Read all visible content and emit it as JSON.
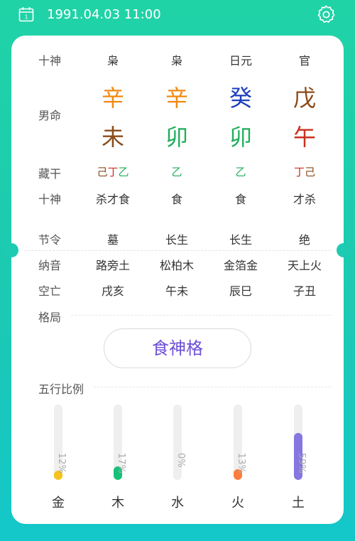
{
  "header": {
    "datetime": "1991.04.03 11:00"
  },
  "colors": {
    "metal": "#f5a623",
    "wood": "#1fae5a",
    "water": "#1c3dbd",
    "fire": "#c8321e",
    "earth": "#8a4b1a",
    "wood_fill": "#16c27a",
    "fire_fill": "#ff7d3b",
    "metal_fill": "#f6c21c",
    "earth_fill": "#8576e0"
  },
  "labels": {
    "shishen": "十神",
    "nanming": "男命",
    "canggan": "藏干",
    "shishen2": "十神",
    "jieling": "节令",
    "nayin": "纳音",
    "kongwang": "空亡",
    "geju": "格局",
    "wuxing": "五行比例"
  },
  "pillars": [
    {
      "shishen": "枭",
      "gan": "辛",
      "zhi": "未",
      "canggan": [
        "己",
        "丁",
        "乙"
      ],
      "shishen2": "杀才食",
      "jieling": "墓",
      "nayin": "路旁土",
      "kongwang": "戌亥"
    },
    {
      "shishen": "枭",
      "gan": "辛",
      "zhi": "卯",
      "canggan": [
        "乙"
      ],
      "shishen2": "食",
      "jieling": "长生",
      "nayin": "松柏木",
      "kongwang": "午未"
    },
    {
      "shishen": "日元",
      "gan": "癸",
      "zhi": "卯",
      "canggan": [
        "乙"
      ],
      "shishen2": "食",
      "jieling": "长生",
      "nayin": "金箔金",
      "kongwang": "辰巳"
    },
    {
      "shishen": "官",
      "gan": "戊",
      "zhi": "午",
      "canggan": [
        "丁",
        "己"
      ],
      "shishen2": "才杀",
      "jieling": "绝",
      "nayin": "天上火",
      "kongwang": "子丑"
    }
  ],
  "pattern": {
    "label": "食神格"
  },
  "elements": [
    {
      "name": "金",
      "percent_label": "12%",
      "value": 0.12
    },
    {
      "name": "木",
      "percent_label": "17%",
      "value": 0.17
    },
    {
      "name": "水",
      "percent_label": "0%",
      "value": 0.0
    },
    {
      "name": "火",
      "percent_label": "13%",
      "value": 0.13
    },
    {
      "name": "土",
      "percent_label": "59%",
      "value": 0.59
    }
  ]
}
